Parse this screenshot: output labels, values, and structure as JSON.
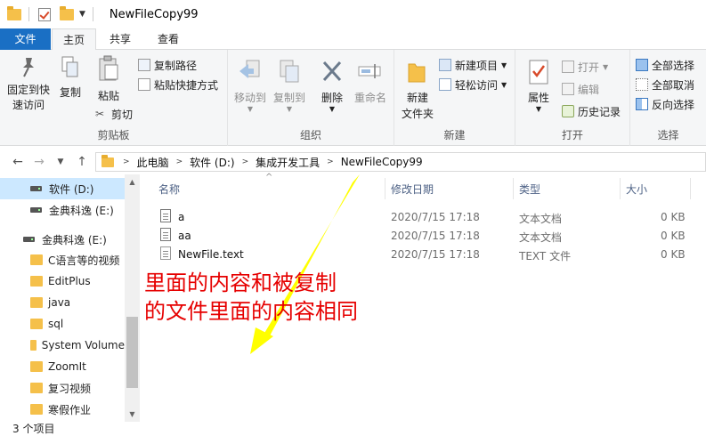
{
  "window": {
    "title": "NewFileCopy99"
  },
  "tabs": {
    "file": "文件",
    "home": "主页",
    "share": "共享",
    "view": "查看"
  },
  "ribbon": {
    "clipboard": {
      "label": "剪贴板",
      "pin": "固定到快速访问",
      "copy": "复制",
      "paste": "粘贴",
      "copy_path": "复制路径",
      "paste_shortcut": "粘贴快捷方式",
      "cut": "剪切"
    },
    "organize": {
      "label": "组织",
      "move_to": "移动到",
      "copy_to": "复制到",
      "delete": "删除",
      "rename": "重命名"
    },
    "new": {
      "label": "新建",
      "new_folder": "新建\n文件夹",
      "new_item": "新建项目",
      "easy_access": "轻松访问"
    },
    "open": {
      "label": "打开",
      "properties": "属性",
      "open": "打开",
      "edit": "编辑",
      "history": "历史记录"
    },
    "select": {
      "label": "选择",
      "select_all": "全部选择",
      "select_none": "全部取消",
      "invert": "反向选择"
    }
  },
  "address": {
    "crumbs": [
      "此电脑",
      "软件 (D:)",
      "集成开发工具",
      "NewFileCopy99"
    ]
  },
  "nav": {
    "items": [
      {
        "label": "软件 (D:)",
        "type": "drive",
        "selected": true
      },
      {
        "label": "金典科逸 (E:)",
        "type": "drive"
      },
      {
        "label": "金典科逸 (E:)",
        "type": "drive"
      },
      {
        "label": "C语言等的视频",
        "type": "folder"
      },
      {
        "label": "EditPlus",
        "type": "folder"
      },
      {
        "label": "java",
        "type": "folder"
      },
      {
        "label": "sql",
        "type": "folder"
      },
      {
        "label": "System Volume",
        "type": "folder"
      },
      {
        "label": "ZoomIt",
        "type": "folder"
      },
      {
        "label": "复习视频",
        "type": "folder"
      },
      {
        "label": "寒假作业",
        "type": "folder"
      }
    ]
  },
  "columns": {
    "name": "名称",
    "modified": "修改日期",
    "type": "类型",
    "size": "大小"
  },
  "files": [
    {
      "name": "a",
      "modified": "2020/7/15 17:18",
      "type": "文本文档",
      "size": "0 KB"
    },
    {
      "name": "aa",
      "modified": "2020/7/15 17:18",
      "type": "文本文档",
      "size": "0 KB"
    },
    {
      "name": "NewFile.text",
      "modified": "2020/7/15 17:18",
      "type": "TEXT 文件",
      "size": "0 KB"
    }
  ],
  "annotation": {
    "line1": "里面的内容和被复制",
    "line2": "的文件里面的内容相同"
  },
  "status": {
    "count": "3 个项目"
  },
  "colors": {
    "accent": "#1a6fc4",
    "annotation": "#e60000",
    "arrow": "#ffff00",
    "selected": "#cce8ff"
  }
}
